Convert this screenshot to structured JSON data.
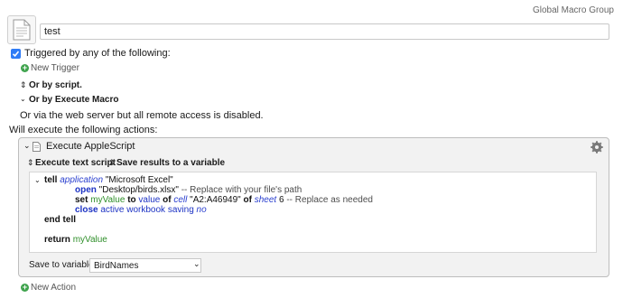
{
  "header": {
    "group_name": "Global Macro Group",
    "macro_name": "test",
    "icon": "document-icon"
  },
  "triggers": {
    "label": "Triggered by any of the following:",
    "checked": true,
    "new_trigger": "New Trigger",
    "or_by_script": "Or by script.",
    "or_by_execute_macro": "Or by Execute Macro",
    "web_server_note": "Or via the web server but all remote access is disabled."
  },
  "actions": {
    "label": "Will execute the following actions:",
    "new_action": "New Action"
  },
  "action": {
    "title": "Execute AppleScript",
    "execute_mode": "Execute text script",
    "save_mode": "Save results to a variable",
    "save_to_label": "Save to variable:",
    "save_to_value": "BirdNames",
    "script": {
      "l1_tell": "tell",
      "l1_application": "application",
      "l1_app_name": "\"Microsoft Excel\"",
      "l2_open": "open",
      "l2_path": "\"Desktop/birds.xlsx\"",
      "l2_comment": "-- Replace with your file's path",
      "l3_set": "set",
      "l3_var": "myValue",
      "l3_to": "to",
      "l3_value": "value",
      "l3_of1": "of",
      "l3_cell": "cell",
      "l3_range": "\"A2:A46949\"",
      "l3_of2": "of",
      "l3_sheet": "sheet",
      "l3_sheet_num": "6",
      "l3_comment": "-- Replace as needed",
      "l4_close": "close",
      "l4_active_workbook": "active workbook",
      "l4_saving": "saving",
      "l4_no": "no",
      "l5_end_tell": "end tell",
      "l6_return": "return",
      "l6_var": "myValue"
    }
  }
}
